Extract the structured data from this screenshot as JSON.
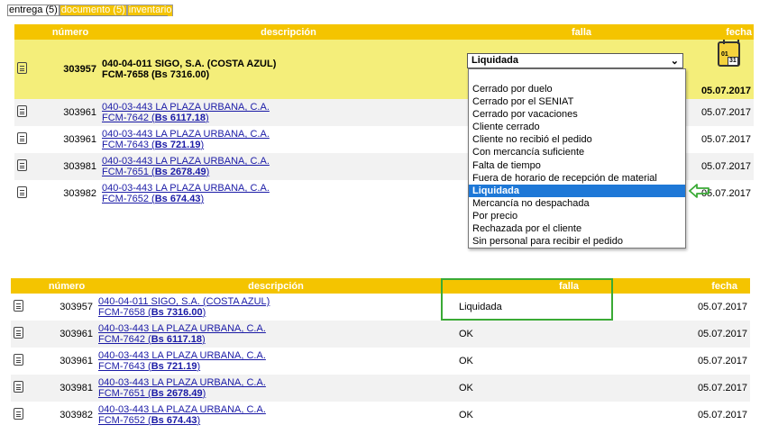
{
  "tabs": [
    {
      "label": "entrega (5)",
      "active": true
    },
    {
      "label": "documento (5)",
      "active": false
    },
    {
      "label": "inventario",
      "active": false
    }
  ],
  "columns": {
    "numero": "número",
    "descripcion": "descripción",
    "falla": "falla",
    "fecha": "fecha"
  },
  "table1": {
    "selected": {
      "numero": "303957",
      "line1": "040-04-011 SIGO, S.A. (COSTA AZUL)",
      "line2": "FCM-7658 (Bs 7316.00)",
      "falla": "Liquidada",
      "fecha": "05.07.2017"
    },
    "rows": [
      {
        "numero": "303961",
        "link1": "040-03-443 LA PLAZA URBANA, C.A.",
        "doc": "FCM-7642",
        "amount": "Bs 6117.18",
        "fecha": "05.07.2017"
      },
      {
        "numero": "303961",
        "link1": "040-03-443 LA PLAZA URBANA, C.A.",
        "doc": "FCM-7643",
        "amount": "Bs 721.19",
        "fecha": "05.07.2017"
      },
      {
        "numero": "303981",
        "link1": "040-03-443 LA PLAZA URBANA, C.A.",
        "doc": "FCM-7651",
        "amount": "Bs 2678.49",
        "fecha": "05.07.2017"
      },
      {
        "numero": "303982",
        "link1": "040-03-443 LA PLAZA URBANA, C.A.",
        "doc": "FCM-7652",
        "amount": "Bs 674.43",
        "fecha": "05.07.2017"
      }
    ]
  },
  "dropdown": {
    "selected_value": "Liquidada",
    "options": [
      "Cerrado por duelo",
      "Cerrado por el SENIAT",
      "Cerrado por vacaciones",
      "Cliente cerrado",
      "Cliente no recibió el pedido",
      "Con mercancía suficiente",
      "Falta de tiempo",
      "Fuera de horario de recepción de material",
      "Liquidada",
      "Mercancía no despachada",
      "Por precio",
      "Rechazada por el cliente",
      "Sin personal para recibir el pedido"
    ],
    "highlighted_index": 8,
    "highlight_color": "#1e78d7"
  },
  "calendar_icon": {
    "label1": "01",
    "label2": "31"
  },
  "table2": {
    "rows": [
      {
        "numero": "303957",
        "link1": "040-04-011 SIGO, S.A. (COSTA AZUL)",
        "doc": "FCM-7658",
        "amount": "Bs 7316.00",
        "falla": "Liquidada",
        "fecha": "05.07.2017"
      },
      {
        "numero": "303961",
        "link1": "040-03-443 LA PLAZA URBANA, C.A.",
        "doc": "FCM-7642",
        "amount": "Bs 6117.18",
        "falla": "OK",
        "fecha": "05.07.2017"
      },
      {
        "numero": "303961",
        "link1": "040-03-443 LA PLAZA URBANA, C.A.",
        "doc": "FCM-7643",
        "amount": "Bs 721.19",
        "falla": "OK",
        "fecha": "05.07.2017"
      },
      {
        "numero": "303981",
        "link1": "040-03-443 LA PLAZA URBANA, C.A.",
        "doc": "FCM-7651",
        "amount": "Bs 2678.49",
        "falla": "OK",
        "fecha": "05.07.2017"
      },
      {
        "numero": "303982",
        "link1": "040-03-443 LA PLAZA URBANA, C.A.",
        "doc": "FCM-7652",
        "amount": "Bs 674.43",
        "falla": "OK",
        "fecha": "05.07.2017"
      }
    ]
  },
  "colors": {
    "header": "#f4c400",
    "selected_row": "#f4ee7a",
    "link": "#1a1aa6",
    "annotation": "#3aaa35"
  },
  "icons": {
    "row": "list-doc-icon",
    "calendar": "calendar-icon",
    "arrow": "arrow-left-icon"
  }
}
